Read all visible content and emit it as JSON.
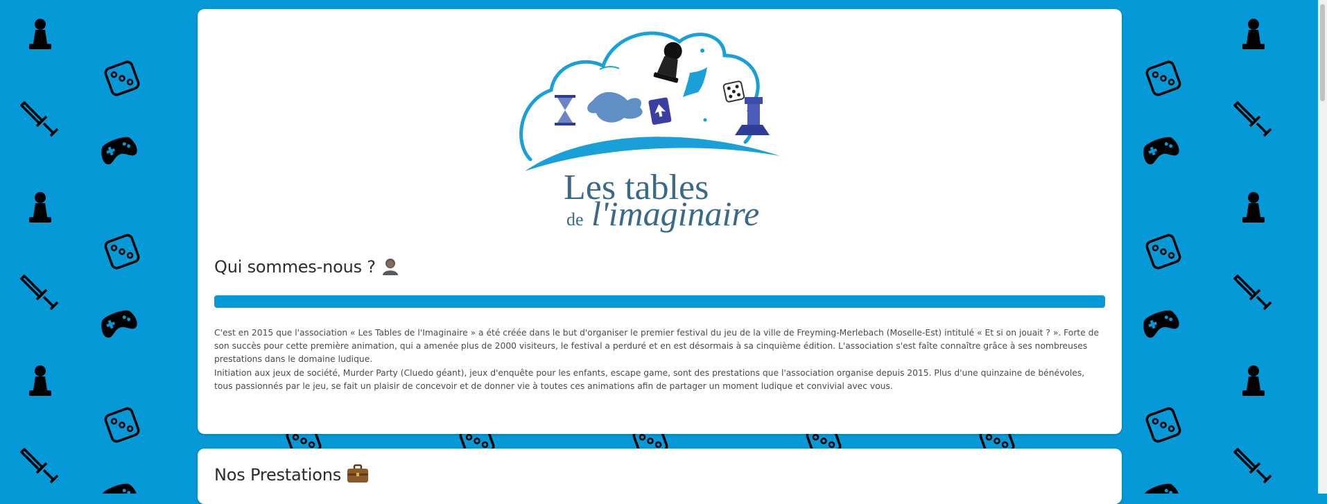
{
  "brand": {
    "logo_alt": "Les tables de l'imaginaire",
    "logo_line1": "Les tables",
    "logo_line2_small": "de",
    "logo_line2": "l'imaginaire"
  },
  "about": {
    "title": "Qui sommes-nous ?",
    "title_emoji": "person-icon",
    "paragraphs": [
      "C'est en 2015 que l'association « Les Tables de l'Imaginaire » a été créée dans le but d'organiser le premier festival du jeu de la ville de Freyming-Merlebach (Moselle-Est) intitulé « Et si on jouait ? ». Forte de son succès pour cette première animation, qui a amenée plus de 2000 visiteurs, le festival a perduré et en est désormais à sa cinquième édition. L'association s'est faîte connaître grâce à ses nombreuses prestations dans le domaine ludique.",
      "Initiation aux jeux de société, Murder Party (Cluedo géant), jeux d'enquête pour les enfants, escape game, sont des prestations que l'association organise depuis 2015. Plus d'une quinzaine de bénévoles, tous passionnés par le jeu, se fait un plaisir de concevoir et de donner vie à toutes ces animations afin de partager un moment ludique et convivial avec vous."
    ]
  },
  "services": {
    "title": "Nos Prestations",
    "title_emoji": "briefcase-icon"
  },
  "colors": {
    "background": "#0699d8",
    "accent": "#0699d8",
    "logo_text": "#3a6a8a"
  },
  "background_icons": [
    "pawn-icon",
    "dice-icon",
    "sword-icon",
    "gamepad-icon"
  ]
}
